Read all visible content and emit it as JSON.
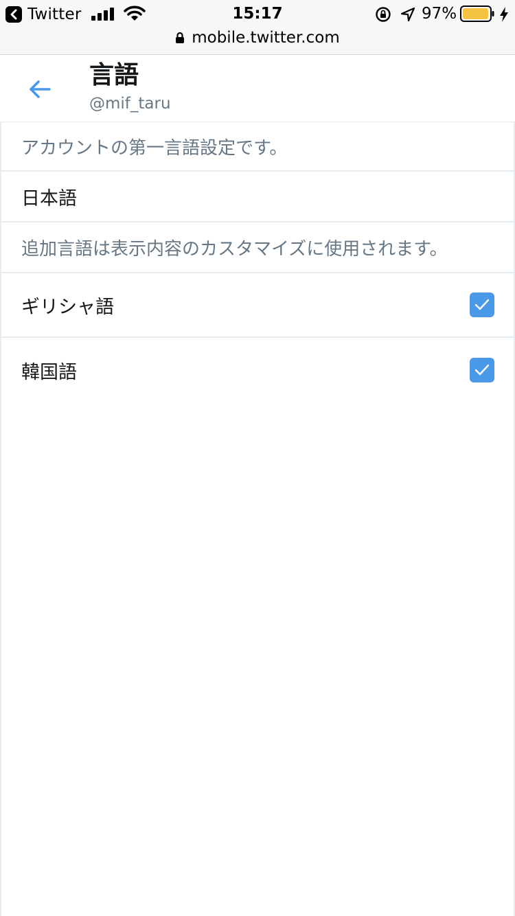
{
  "status_bar": {
    "back_app_label": "Twitter",
    "time": "15:17",
    "battery_percent_text": "97%",
    "battery_level": 0.97,
    "battery_color": "#f5c342",
    "url": "mobile.twitter.com"
  },
  "header": {
    "title": "言語",
    "subtitle": "@mif_taru",
    "accent_color": "#4a99e9"
  },
  "settings": {
    "primary_description": "アカウントの第一言語設定です。",
    "primary_language": "日本語",
    "additional_description": "追加言語は表示内容のカスタマイズに使用されます。",
    "additional_languages": [
      {
        "label": "ギリシャ語",
        "checked": true
      },
      {
        "label": "韓国語",
        "checked": true
      }
    ]
  }
}
